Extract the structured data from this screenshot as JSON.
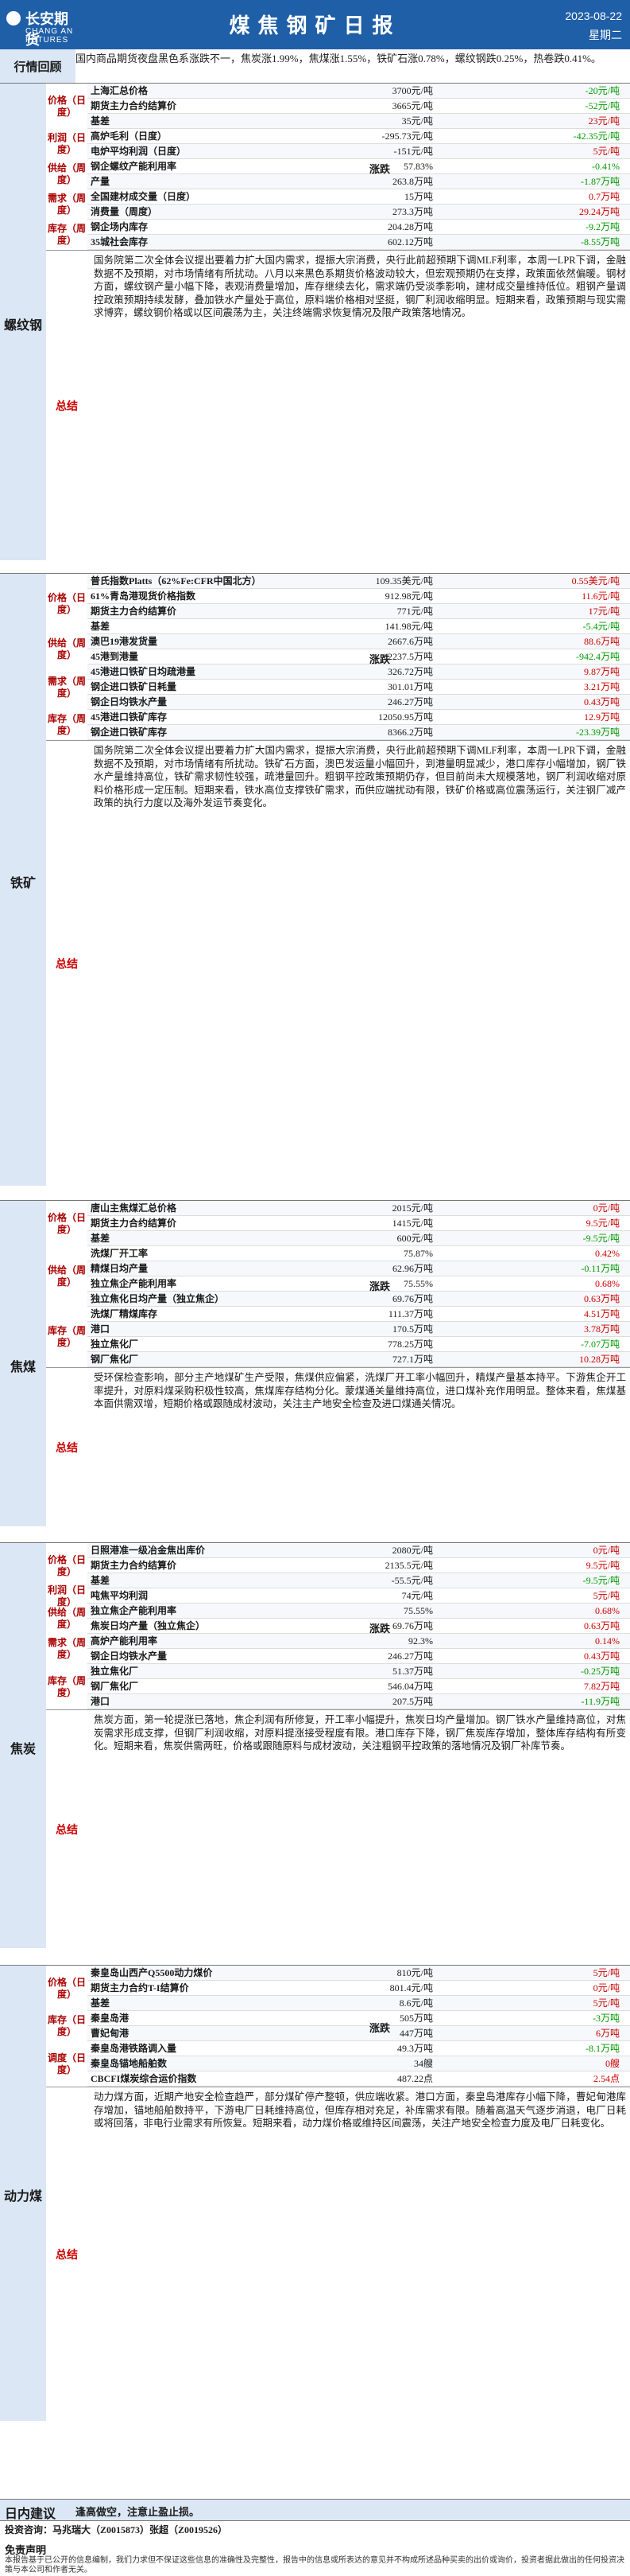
{
  "header": {
    "logo_cn": "长安期货",
    "logo_en": "CHANG AN FUTURES",
    "title": "煤焦钢矿日报",
    "date": "2023-08-22",
    "weekday": "星期二"
  },
  "review": {
    "label": "行情回顾",
    "text": "国内商品期货夜盘黑色系涨跌不一，焦炭涨1.99%，焦煤涨1.55%，铁矿石涨0.78%，螺纹钢跌0.25%，热卷跌0.41%。"
  },
  "rebar": {
    "label": "螺纹钢",
    "groups": [
      {
        "name": "价格（日度）"
      },
      {
        "name": "利润（日度）"
      },
      {
        "name": "供给（周度）"
      },
      {
        "name": "需求（周度）"
      },
      {
        "name": "库存（周度）"
      }
    ],
    "rows": [
      {
        "n": "上海汇总价格",
        "v": "3700元/吨",
        "c": "-20元/吨"
      },
      {
        "n": "期货主力合约结算价",
        "v": "3665元/吨",
        "c": "-52元/吨"
      },
      {
        "n": "基差",
        "v": "35元/吨",
        "c": "23元/吨"
      },
      {
        "n": "高炉毛利（日度）",
        "v": "-295.73元/吨",
        "c": "-42.35元/吨"
      },
      {
        "n": "电炉平均利润（日度）",
        "v": "-151元/吨",
        "c": "5元/吨"
      },
      {
        "n": "钢企螺纹产能利用率",
        "v": "57.83%",
        "c": "-0.41%"
      },
      {
        "n": "产量",
        "v": "263.8万吨",
        "c": "-1.87万吨"
      },
      {
        "n": "全国建材成交量（日度）",
        "v": "15万吨",
        "c": "0.7万吨"
      },
      {
        "n": "消费量（周度）",
        "v": "273.3万吨",
        "c": "29.24万吨"
      },
      {
        "n": "钢企场内库存",
        "v": "204.28万吨",
        "c": "-9.2万吨"
      },
      {
        "n": "35城社会库存",
        "v": "602.12万吨",
        "c": "-8.55万吨"
      }
    ],
    "trend": "涨跌",
    "summary_label": "总结",
    "summary": "国务院第二次全体会议提出要着力扩大国内需求，提振大宗消费，央行此前超预期下调MLF利率，本周一LPR下调，金融数据不及预期，对市场情绪有所扰动。八月以来黑色系期货价格波动较大，但宏观预期仍在支撑，政策面依然偏暖。钢材方面，螺纹钢产量小幅下降，表观消费量增加，库存继续去化，需求端仍受淡季影响，建材成交量维持低位。粗钢产量调控政策预期持续发酵，叠加铁水产量处于高位，原料端价格相对坚挺，钢厂利润收缩明显。短期来看，政策预期与现实需求博弈，螺纹钢价格或以区间震荡为主，关注终端需求恢复情况及限产政策落地情况。"
  },
  "iron": {
    "label": "铁矿",
    "groups": [
      {
        "name": "价格（日度）"
      },
      {
        "name": "供给（周度）"
      },
      {
        "name": "需求（周度）"
      },
      {
        "name": "库存（周度）"
      }
    ],
    "rows": [
      {
        "n": "普氏指数Platts（62%Fe:CFR中国北方）",
        "v": "109.35美元/吨",
        "c": "0.55美元/吨"
      },
      {
        "n": "61%青岛港现货价格指数",
        "v": "912.98元/吨",
        "c": "11.6元/吨"
      },
      {
        "n": "期货主力合约结算价",
        "v": "771元/吨",
        "c": "17元/吨"
      },
      {
        "n": "基差",
        "v": "141.98元/吨",
        "c": "-5.4元/吨"
      },
      {
        "n": "澳巴19港发货量",
        "v": "2667.6万吨",
        "c": "88.6万吨"
      },
      {
        "n": "45港到港量",
        "v": "2237.5万吨",
        "c": "-942.4万吨"
      },
      {
        "n": "45港进口铁矿日均疏港量",
        "v": "326.72万吨",
        "c": "9.87万吨"
      },
      {
        "n": "钢企进口铁矿日耗量",
        "v": "301.01万吨",
        "c": "3.21万吨"
      },
      {
        "n": "钢企日均铁水产量",
        "v": "246.27万吨",
        "c": "0.43万吨"
      },
      {
        "n": "45港进口铁矿库存",
        "v": "12050.95万吨",
        "c": "12.9万吨"
      },
      {
        "n": "钢企进口铁矿库存",
        "v": "8366.2万吨",
        "c": "-23.39万吨"
      }
    ],
    "trend": "涨跌",
    "summary_label": "总结",
    "summary": "国务院第二次全体会议提出要着力扩大国内需求，提振大宗消费，央行此前超预期下调MLF利率，本周一LPR下调，金融数据不及预期，对市场情绪有所扰动。铁矿石方面，澳巴发运量小幅回升，到港量明显减少，港口库存小幅增加，钢厂铁水产量维持高位，铁矿需求韧性较强，疏港量回升。粗钢平控政策预期仍存，但目前尚未大规模落地，钢厂利润收缩对原料价格形成一定压制。短期来看，铁水高位支撑铁矿需求，而供应端扰动有限，铁矿价格或高位震荡运行，关注钢厂减产政策的执行力度以及海外发运节奏变化。"
  },
  "coke": {
    "label": "焦煤",
    "groups": [
      {
        "name": "价格（日度）"
      },
      {
        "name": "供给（周度）"
      },
      {
        "name": "库存（周度）"
      }
    ],
    "rows": [
      {
        "n": "唐山主焦煤汇总价格",
        "v": "2015元/吨",
        "c": "0元/吨"
      },
      {
        "n": "期货主力合约结算价",
        "v": "1415元/吨",
        "c": "9.5元/吨"
      },
      {
        "n": "基差",
        "v": "600元/吨",
        "c": "-9.5元/吨"
      },
      {
        "n": "洗煤厂开工率",
        "v": "75.87%",
        "c": "0.42%"
      },
      {
        "n": "精煤日均产量",
        "v": "62.96万吨",
        "c": "-0.11万吨"
      },
      {
        "n": "独立焦企产能利用率",
        "v": "75.55%",
        "c": "0.68%"
      },
      {
        "n": "独立焦化日均产量（独立焦企）",
        "v": "69.76万吨",
        "c": "0.63万吨"
      },
      {
        "n": "洗煤厂精煤库存",
        "v": "111.37万吨",
        "c": "4.51万吨"
      },
      {
        "n": "港口",
        "v": "170.5万吨",
        "c": "3.78万吨"
      },
      {
        "n": "独立焦化厂",
        "v": "778.25万吨",
        "c": "-7.07万吨"
      },
      {
        "n": "钢厂焦化厂",
        "v": "727.1万吨",
        "c": "10.28万吨"
      }
    ],
    "trend": "涨跌",
    "summary_label": "总结",
    "summary": "受环保检查影响，部分主产地煤矿生产受限，焦煤供应偏紧，洗煤厂开工率小幅回升，精煤产量基本持平。下游焦企开工率提升，对原料煤采购积极性较高，焦煤库存结构分化。蒙煤通关量维持高位，进口煤补充作用明显。整体来看，焦煤基本面供需双增，短期价格或跟随成材波动，关注主产地安全检查及进口煤通关情况。"
  },
  "coal": {
    "label": "焦炭",
    "groups": [
      {
        "name": "价格（日度）"
      },
      {
        "name": "利润（日度）"
      },
      {
        "name": "供给（周度）"
      },
      {
        "name": "需求（周度）"
      },
      {
        "name": "库存（周度）"
      }
    ],
    "rows": [
      {
        "n": "日照港准一级冶金焦出库价",
        "v": "2080元/吨",
        "c": "0元/吨"
      },
      {
        "n": "期货主力合约结算价",
        "v": "2135.5元/吨",
        "c": "9.5元/吨"
      },
      {
        "n": "基差",
        "v": "-55.5元/吨",
        "c": "-9.5元/吨"
      },
      {
        "n": "吨焦平均利润",
        "v": "74元/吨",
        "c": "5元/吨"
      },
      {
        "n": "独立焦企产能利用率",
        "v": "75.55%",
        "c": "0.68%"
      },
      {
        "n": "焦炭日均产量（独立焦企）",
        "v": "69.76万吨",
        "c": "0.63万吨"
      },
      {
        "n": "高炉产能利用率",
        "v": "92.3%",
        "c": "0.14%"
      },
      {
        "n": "钢企日均铁水产量",
        "v": "246.27万吨",
        "c": "0.43万吨"
      },
      {
        "n": "独立焦化厂",
        "v": "51.37万吨",
        "c": "-0.25万吨"
      },
      {
        "n": "钢厂焦化厂",
        "v": "546.04万吨",
        "c": "7.82万吨"
      },
      {
        "n": "港口",
        "v": "207.5万吨",
        "c": "-11.9万吨"
      }
    ],
    "trend": "涨跌",
    "summary_label": "总结",
    "summary": "焦炭方面，第一轮提涨已落地，焦企利润有所修复，开工率小幅提升，焦炭日均产量增加。钢厂铁水产量维持高位，对焦炭需求形成支撑，但钢厂利润收缩，对原料提涨接受程度有限。港口库存下降，钢厂焦炭库存增加，整体库存结构有所变化。短期来看，焦炭供需两旺，价格或跟随原料与成材波动，关注粗钢平控政策的落地情况及钢厂补库节奏。"
  },
  "thermal": {
    "label": "动力煤",
    "groups": [
      {
        "name": "价格（日度）"
      },
      {
        "name": "库存（日度）"
      },
      {
        "name": "调度（日度）"
      }
    ],
    "rows": [
      {
        "n": "秦皇岛山西产Q5500动力煤价",
        "v": "810元/吨",
        "c": "5元/吨"
      },
      {
        "n": "期货主力合约T-I结算价",
        "v": "801.4元/吨",
        "c": "0元/吨"
      },
      {
        "n": "基差",
        "v": "8.6元/吨",
        "c": "5元/吨"
      },
      {
        "n": "秦皇岛港",
        "v": "505万吨",
        "c": "-3万吨"
      },
      {
        "n": "曹妃甸港",
        "v": "447万吨",
        "c": "6万吨"
      },
      {
        "n": "秦皇岛港铁路调入量",
        "v": "49.3万吨",
        "c": "-8.1万吨"
      },
      {
        "n": "秦皇岛锚地船舶数",
        "v": "34艘",
        "c": "0艘"
      },
      {
        "n": "CBCFI煤炭综合运价指数",
        "v": "487.22点",
        "c": "2.54点"
      }
    ],
    "trend": "涨跌",
    "summary_label": "总结",
    "summary": "动力煤方面，近期产地安全检查趋严，部分煤矿停产整顿，供应端收紧。港口方面，秦皇岛港库存小幅下降，曹妃甸港库存增加，锚地船舶数持平，下游电厂日耗维持高位，但库存相对充足，补库需求有限。随着高温天气逐步消退，电厂日耗或将回落，非电行业需求有所恢复。短期来看，动力煤价格或维持区间震荡，关注产地安全检查力度及电厂日耗变化。"
  },
  "advice": {
    "label": "日内建议",
    "text": "逢高做空，注意止盈止损。"
  },
  "contact": "投资咨询：马兆瑞大（Z0015873）张超（Z0019526）",
  "disclaimer_title": "免责声明",
  "disclaimer": "本报告基于已公开的信息编制，我们力求但不保证这些信息的准确性及完整性，报告中的信息或所表达的意见并不构成所述品种买卖的出价或询价，投资者据此做出的任何投资决策与本公司和作者无关。"
}
